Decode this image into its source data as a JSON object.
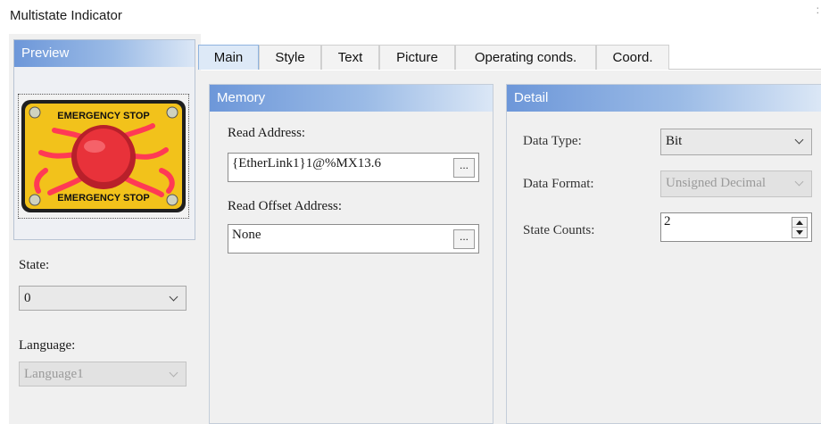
{
  "window": {
    "title": "Multistate Indicator"
  },
  "left": {
    "preview_header": "Preview",
    "image_text": "EMERGENCY STOP",
    "state_label": "State:",
    "state_value": "0",
    "language_label": "Language:",
    "language_value": "Language1"
  },
  "tabs": [
    {
      "label": "Main",
      "active": true
    },
    {
      "label": "Style",
      "active": false
    },
    {
      "label": "Text",
      "active": false
    },
    {
      "label": "Picture",
      "active": false
    },
    {
      "label": "Operating conds.",
      "active": false
    },
    {
      "label": "Coord.",
      "active": false
    }
  ],
  "memory": {
    "header": "Memory",
    "read_address_label": "Read Address:",
    "read_address_value": "{EtherLink1}1@%MX13.6",
    "read_offset_label": "Read Offset Address:",
    "read_offset_value": "None",
    "browse_label": "..."
  },
  "detail": {
    "header": "Detail",
    "data_type_label": "Data Type:",
    "data_type_value": "Bit",
    "data_format_label": "Data Format:",
    "data_format_value": "Unsigned Decimal",
    "state_counts_label": "State Counts:",
    "state_counts_value": "2"
  },
  "colors": {
    "header_gradient_start": "#6d97d9",
    "sign_yellow": "#f2c21b",
    "button_red": "#e8323a"
  }
}
